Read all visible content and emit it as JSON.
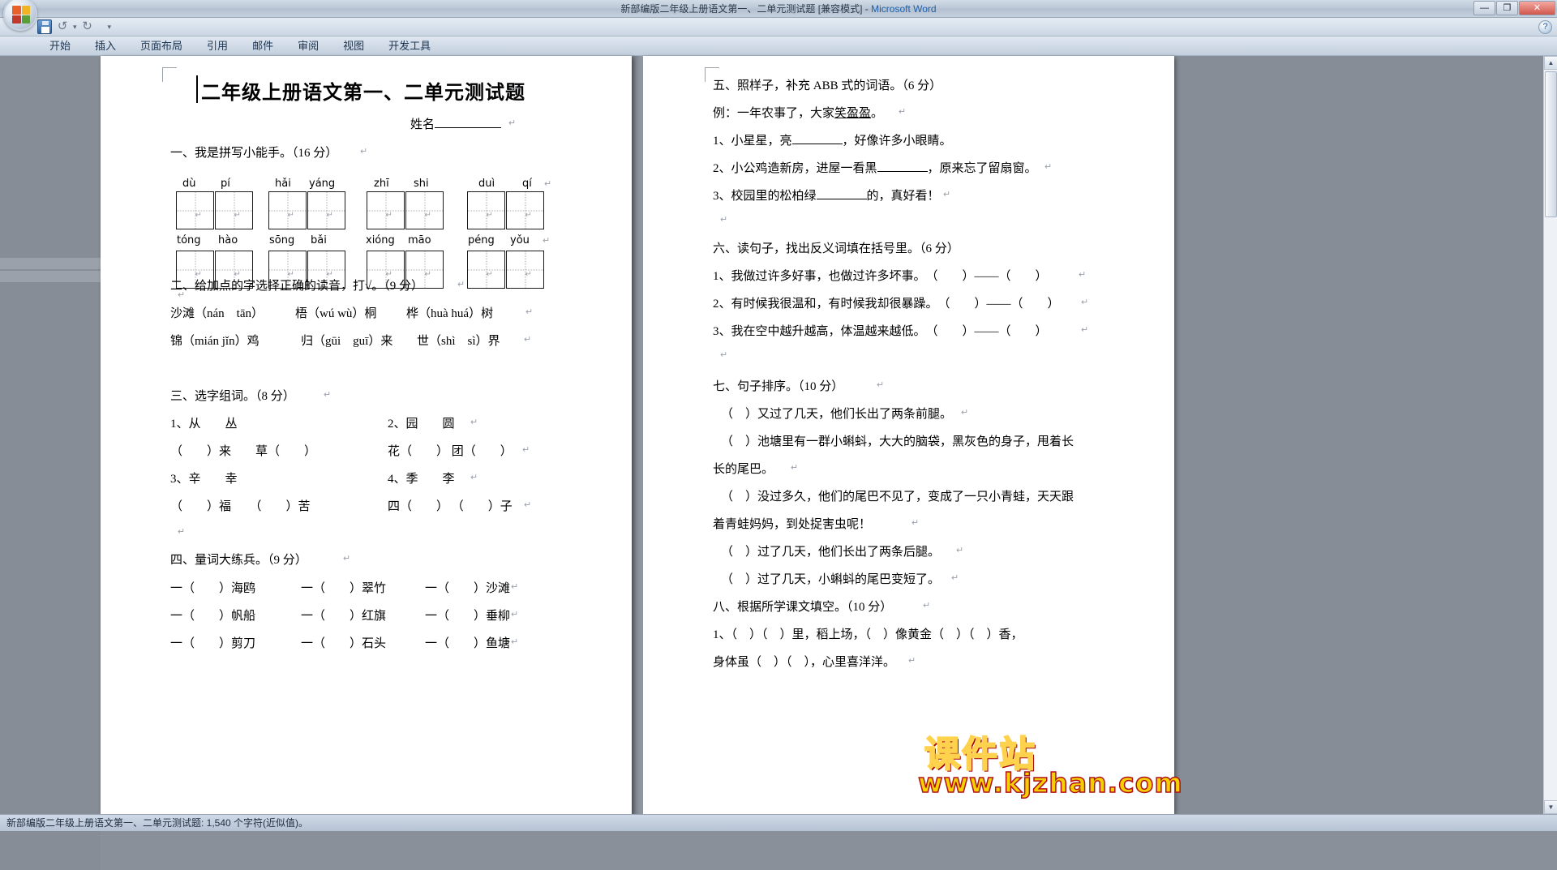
{
  "window": {
    "title": "新部编版二年级上册语文第一、二单元测试题 [兼容模式]",
    "separator": " - ",
    "app_name": "Microsoft Word",
    "minimize": "—",
    "maximize": "❐",
    "close": "✕",
    "help": "?"
  },
  "quick_access": {
    "office_button": "office-button",
    "save": "save-icon",
    "undo": "↺",
    "redo": "↻",
    "customize": "▾"
  },
  "ribbon": {
    "tabs": [
      {
        "label": "开始",
        "active": false
      },
      {
        "label": "插入",
        "active": false
      },
      {
        "label": "页面布局",
        "active": false
      },
      {
        "label": "引用",
        "active": false
      },
      {
        "label": "邮件",
        "active": false
      },
      {
        "label": "审阅",
        "active": false
      },
      {
        "label": "视图",
        "active": false
      },
      {
        "label": "开发工具",
        "active": false
      }
    ]
  },
  "statusbar": {
    "text": "新部编版二年级上册语文第一、二单元测试题: 1,540 个字符(近似值)。"
  },
  "scrollbar": {
    "up_arrow": "▲",
    "down_arrow": "▼"
  },
  "document": {
    "title": "二年级上册语文第一、二单元测试题",
    "name_field": "姓名",
    "name_blank": "________",
    "pilcrow": "↵",
    "section1": {
      "heading": "一、我是拼写小能手。（16 分）",
      "groups": [
        {
          "top": [
            "dù",
            "pí"
          ],
          "bottom": [
            "tóng",
            "hào"
          ]
        },
        {
          "top": [
            "hǎi",
            "yáng"
          ],
          "bottom": [
            "sōng",
            "bǎi"
          ]
        },
        {
          "top": [
            "zhī",
            "shi"
          ],
          "bottom": [
            "xióng",
            "māo"
          ]
        },
        {
          "top": [
            "duì",
            "qí"
          ],
          "bottom": [
            "péng",
            "yǒu"
          ]
        }
      ]
    },
    "section2": {
      "heading": "二、给加点的字选择正确的读音，打√。（9 分）",
      "rows": [
        [
          "沙滩（nán　tān）",
          "梧（wú  wù）桐",
          "桦（huà  huá）树"
        ],
        [
          "锦（mián  jǐn）鸡",
          "归（gūi　guī）来",
          "世（shì　sì）界"
        ]
      ]
    },
    "section3": {
      "heading": "三、选字组词。（8 分）",
      "items": [
        {
          "left_label": "1、从　　丛",
          "left_answer": "（　　）来　　草（　　）",
          "right_label": "2、园　　圆",
          "right_answer": "花（　　）  团（　　）"
        },
        {
          "left_label": "3、辛　　幸",
          "left_answer": "（　　）福　　（　　）苦",
          "right_label": "4、季　　李",
          "right_answer": "四（　　）  （　　）子"
        }
      ]
    },
    "section4": {
      "heading": "四、量词大练兵。（9 分）",
      "rows": [
        [
          "一（　　）海鸥",
          "一（　　）翠竹",
          "一（　　）沙滩"
        ],
        [
          "一（　　）帆船",
          "一（　　）红旗",
          "一（　　）垂柳"
        ],
        [
          "一（　　）剪刀",
          "一（　　）石头",
          "一（　　）鱼塘"
        ]
      ]
    },
    "section5": {
      "heading": "五、照样子，补充 ABB 式的词语。（6 分）",
      "example_prefix": "例：一年农事了，大家",
      "example_underlined": "笑盈盈",
      "example_suffix": "。",
      "items": [
        {
          "pre": "1、小星星，亮",
          "blank": "______",
          "post": "，好像许多小眼睛。"
        },
        {
          "pre": "2、小公鸡造新房，进屋一看黑",
          "blank": "______",
          "post": "，原来忘了留扇窗。"
        },
        {
          "pre": "3、校园里的松柏绿",
          "blank": "______",
          "post": "的，真好看！"
        }
      ]
    },
    "section6": {
      "heading": "六、读句子，找出反义词填在括号里。（6 分）",
      "items": [
        "1、我做过许多好事，也做过许多坏事。　（　　）——（　　）",
        "2、有时候我很温和，有时候我却很暴躁。　（　　）——（　　）",
        "3、我在空中越升越高，体温越来越低。　（　　）——（　　）"
      ]
    },
    "section7": {
      "heading": "七、句子排序。（10 分）",
      "items": [
        "（　）又过了几天，他们长出了两条前腿。",
        "（　）池塘里有一群小蝌蚪，大大的脑袋，黑灰色的身子，甩着长",
        "长的尾巴。",
        "（　）没过多久，他们的尾巴不见了，变成了一只小青蛙，天天跟",
        "着青蛙妈妈，到处捉害虫呢！",
        "（　）过了几天，他们长出了两条后腿。",
        "（　）过了几天，小蝌蚪的尾巴变短了。"
      ]
    },
    "section8": {
      "heading": "八、根据所学课文填空。（10 分）",
      "items": [
        "1、（　）（　）里，稻上场，（　）像黄金（　）（　）香，",
        "身体虽（　）（　），心里喜洋洋。"
      ]
    }
  },
  "watermark": {
    "title": "课件站",
    "url": "www.kjzhan.com"
  }
}
